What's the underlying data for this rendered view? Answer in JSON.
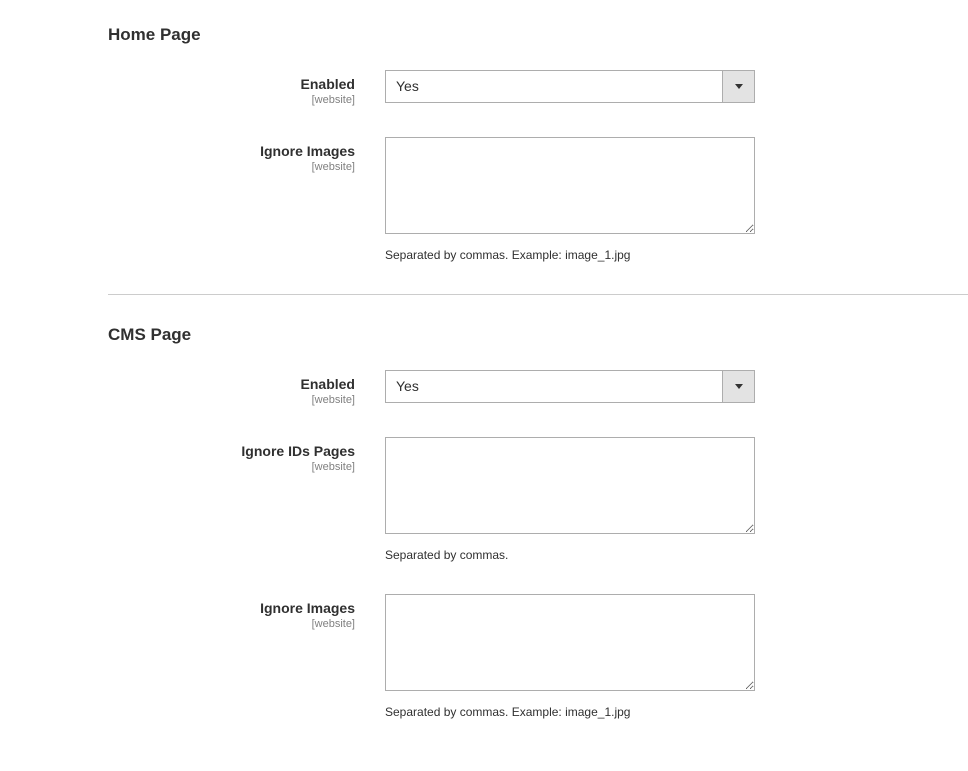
{
  "home_page": {
    "title": "Home Page",
    "enabled": {
      "label": "Enabled",
      "scope": "[website]",
      "value": "Yes"
    },
    "ignore_images": {
      "label": "Ignore Images",
      "scope": "[website]",
      "value": "",
      "help": "Separated by commas. Example: image_1.jpg"
    }
  },
  "cms_page": {
    "title": "CMS Page",
    "enabled": {
      "label": "Enabled",
      "scope": "[website]",
      "value": "Yes"
    },
    "ignore_ids": {
      "label": "Ignore IDs Pages",
      "scope": "[website]",
      "value": "",
      "help": "Separated by commas."
    },
    "ignore_images": {
      "label": "Ignore Images",
      "scope": "[website]",
      "value": "",
      "help": "Separated by commas. Example: image_1.jpg"
    }
  }
}
